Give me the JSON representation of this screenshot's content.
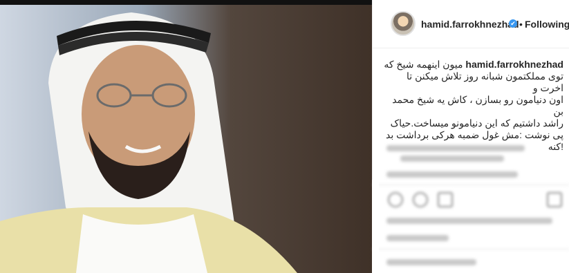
{
  "post": {
    "username": "hamid.farrokhnezhad",
    "verified_mark": "✔",
    "separator": "•",
    "follow_label": "Following",
    "caption_user": "hamid.farrokhnezhad",
    "caption_lines": [
      "میون اینهمه شیخ که",
      "توی مملکتمون شبانه روز تلاش میکنن تا اخرت و",
      "اون دنیامون رو بسازن ، کاش یه شیخ محمد بن",
      "راشد داشتیم که این دنیامونو میساخت.حیاک",
      "پی نوشت :مش غول ضمبه هرکی برداشت بد",
      "!کنه"
    ]
  },
  "icons": {
    "avatar": "avatar-icon",
    "verified": "verified-badge-icon"
  }
}
